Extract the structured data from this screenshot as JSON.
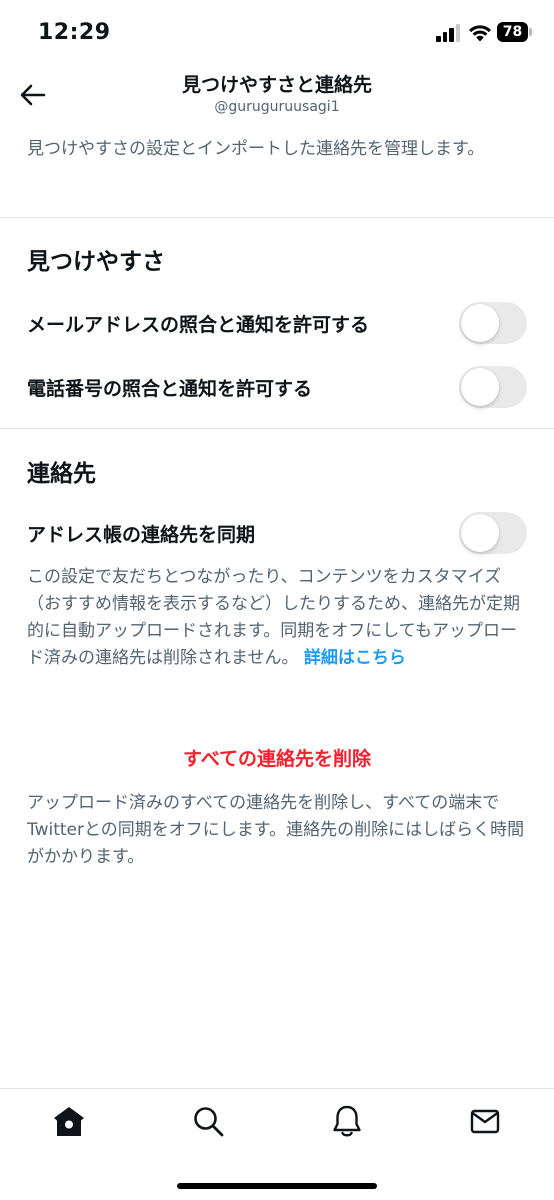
{
  "status_bar": {
    "time": "12:29",
    "battery": "78"
  },
  "header": {
    "title": "見つけやすさと連絡先",
    "username": "@guruguruusagi1"
  },
  "intro": "見つけやすさの設定とインポートした連絡先を管理します。",
  "discoverability": {
    "title": "見つけやすさ",
    "settings": [
      {
        "label": "メールアドレスの照合と通知を許可する",
        "enabled": false
      },
      {
        "label": "電話番号の照合と通知を許可する",
        "enabled": false
      }
    ]
  },
  "contacts": {
    "title": "連絡先",
    "sync": {
      "label": "アドレス帳の連絡先を同期",
      "enabled": false
    },
    "sync_description": "この設定で友だちとつながったり、コンテンツをカスタマイズ（おすすめ情報を表示するなど）したりするため、連絡先が定期的に自動アップロードされます。同期をオフにしてもアップロード済みの連絡先は削除されません。",
    "learn_more": "詳細はこちら",
    "delete_all": "すべての連絡先を削除",
    "delete_description": "アップロード済みのすべての連絡先を削除し、すべての端末でTwitterとの同期をオフにします。連絡先の削除にはしばらく時間がかかります。"
  },
  "tab_bar": {
    "tabs": [
      {
        "icon": "home-icon",
        "active": true
      },
      {
        "icon": "search-icon",
        "active": false
      },
      {
        "icon": "bell-icon",
        "active": false
      },
      {
        "icon": "mail-icon",
        "active": false
      }
    ]
  },
  "colors": {
    "link": "#1d9bf0",
    "danger": "#f4212e",
    "secondary_text": "#536471",
    "toggle_off": "#e9e9ea"
  }
}
